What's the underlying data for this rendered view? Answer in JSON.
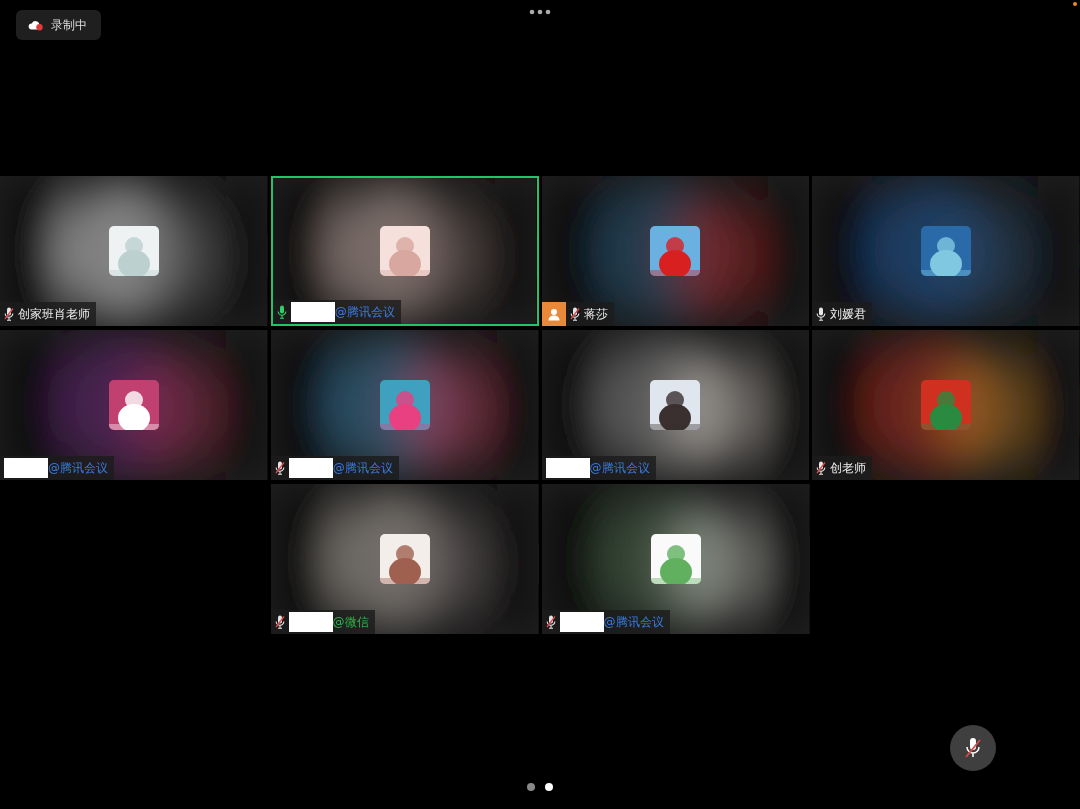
{
  "recording": {
    "label": "录制中"
  },
  "tiles": [
    {
      "name": "创家班肖老师",
      "mic": {
        "muted": true
      },
      "speaking": false
    },
    {
      "redacted": true,
      "suffix": "@腾讯会议",
      "wechat": false,
      "mic": {
        "muted": false
      },
      "speaking": true
    },
    {
      "name": "蒋莎",
      "mic": {
        "muted": true
      },
      "speaking": false,
      "badge": true
    },
    {
      "name": "刘媛君",
      "mic": {
        "muted": false
      },
      "speaking": false
    },
    {
      "redacted": true,
      "suffix": "@腾讯会议",
      "wechat": false,
      "speaking": false
    },
    {
      "redacted": true,
      "suffix": "@腾讯会议",
      "wechat": false,
      "mic": {
        "muted": true
      },
      "speaking": false
    },
    {
      "redacted": true,
      "suffix": "@腾讯会议",
      "wechat": false,
      "speaking": false
    },
    {
      "name": "创老师",
      "mic": {
        "muted": true
      },
      "speaking": false
    },
    {
      "redacted": true,
      "suffix": "@微信",
      "wechat": true,
      "mic": {
        "muted": true
      },
      "speaking": false
    },
    {
      "redacted": true,
      "suffix": "@腾讯会议",
      "wechat": false,
      "mic": {
        "muted": true
      },
      "speaking": false
    }
  ],
  "pages": [
    {
      "selected": false
    },
    {
      "selected": true
    }
  ]
}
